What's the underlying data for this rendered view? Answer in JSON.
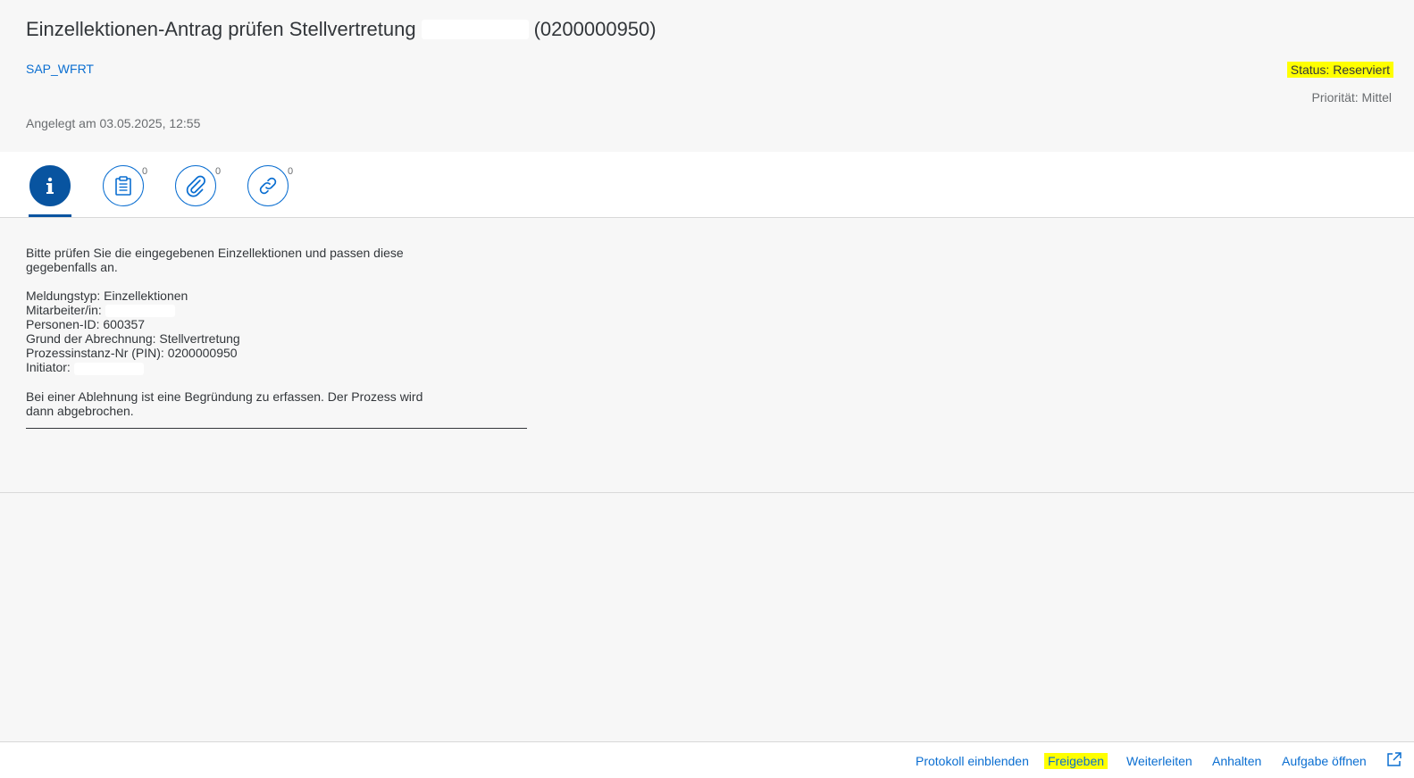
{
  "header": {
    "title_prefix": "Einzellektionen-Antrag prüfen Stellvertretung",
    "title_suffix": "(0200000950)",
    "subtitle": "SAP_WFRT",
    "status": "Status: Reserviert",
    "priority": "Priorität: Mittel",
    "created": "Angelegt am 03.05.2025, 12:55"
  },
  "tabs": [
    {
      "icon": "info-icon",
      "count": ""
    },
    {
      "icon": "notes-icon",
      "count": "0"
    },
    {
      "icon": "attachment-icon",
      "count": "0"
    },
    {
      "icon": "link-icon",
      "count": "0"
    }
  ],
  "content": {
    "intro_line1": "Bitte prüfen Sie die eingegebenen Einzellektionen und passen diese",
    "intro_line2": "gegebenfalls an.",
    "meldungstyp": "Meldungstyp: Einzellektionen",
    "mitarbeiter": "Mitarbeiter/in:",
    "personen_id": "Personen-ID: 600357",
    "grund": "Grund der Abrechnung: Stellvertretung",
    "pin": "Prozessinstanz-Nr (PIN): 0200000950",
    "initiator": "Initiator:",
    "note_line1": "Bei einer Ablehnung ist eine Begründung zu erfassen. Der Prozess wird",
    "note_line2": "dann abgebrochen."
  },
  "footer": {
    "protokoll": "Protokoll einblenden",
    "freigeben": "Freigeben",
    "weiterleiten": "Weiterleiten",
    "anhalten": "Anhalten",
    "aufgabe": "Aufgabe öffnen"
  },
  "colors": {
    "accent": "#0a6ed1",
    "active_tab": "#0854a0",
    "highlight": "#ffff00"
  }
}
